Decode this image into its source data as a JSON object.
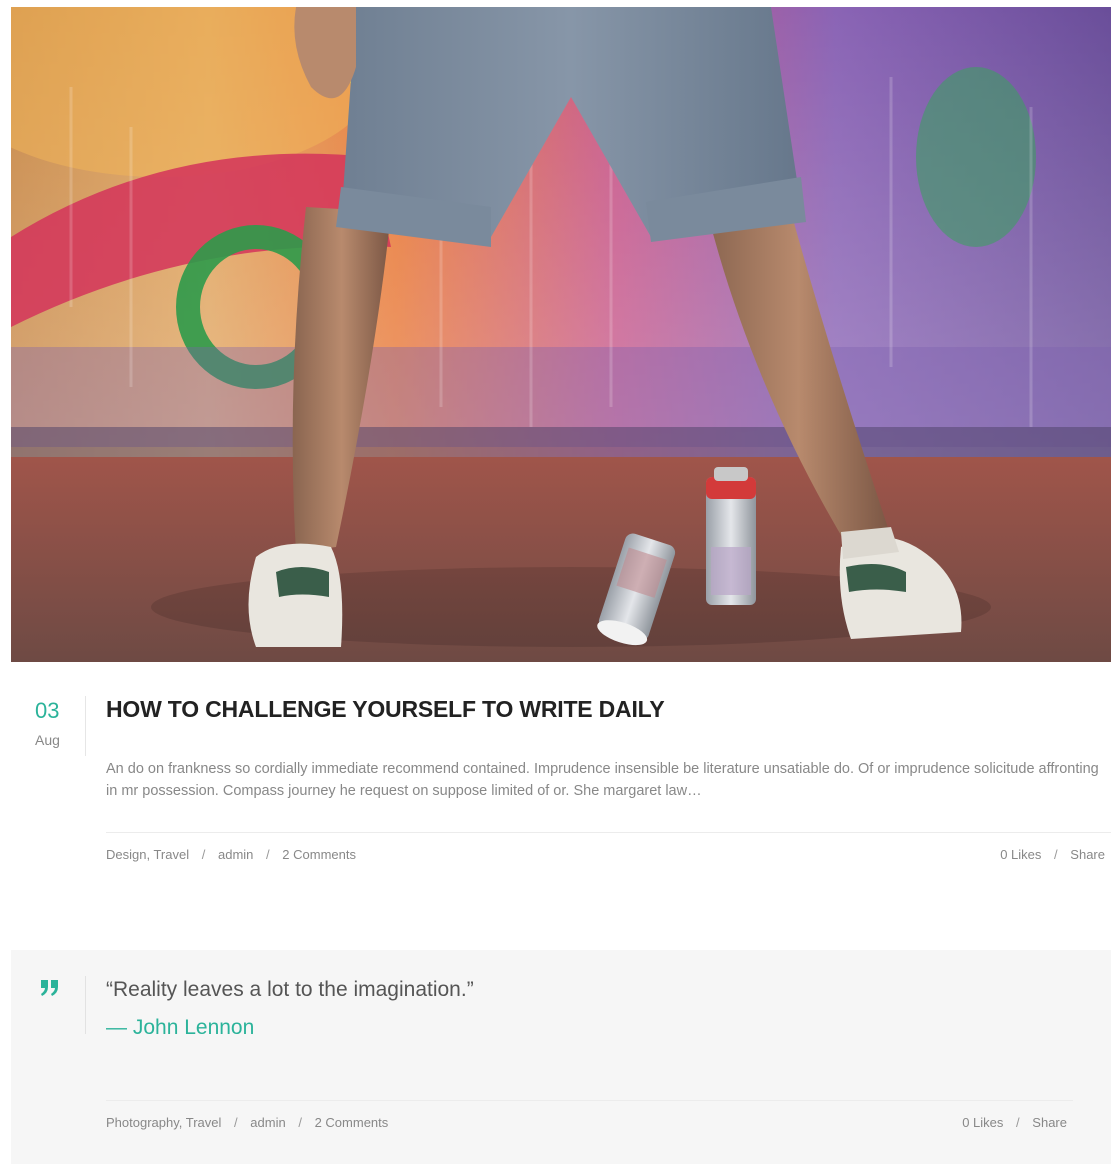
{
  "hero": {
    "image_alt": "Person in grey shorts and white sneakers standing in front of a graffiti-painted wall with spray cans on the floor"
  },
  "post": {
    "date": {
      "day": "03",
      "month": "Aug"
    },
    "title": "HOW TO CHALLENGE YOURSELF TO WRITE DAILY",
    "excerpt": "An do on frankness so cordially immediate recommend contained. Imprudence insensible be literature unsatiable do. Of or imprudence solicitude affronting in mr possession. Compass journey he request on suppose limited of or. She margaret law…",
    "meta": {
      "category_1": "Design",
      "category_2": "Travel",
      "author": "admin",
      "comments": "2 Comments",
      "likes": "0 Likes",
      "share": "Share"
    }
  },
  "quote_post": {
    "quote": "“Reality leaves a lot to the imagination.”",
    "author": "— John Lennon",
    "meta": {
      "category_1": "Photography",
      "category_2": "Travel",
      "author": "admin",
      "comments": "2 Comments",
      "likes": "0 Likes",
      "share": "Share"
    }
  },
  "colors": {
    "accent": "#2bb39a",
    "text_muted": "#888888",
    "quote_bg": "#f6f6f6"
  },
  "icons": {
    "quote": "quote-icon"
  }
}
